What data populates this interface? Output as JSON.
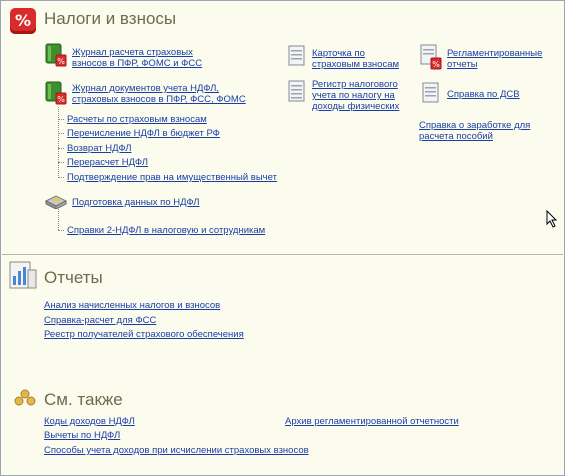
{
  "taxes": {
    "title": "Налоги и взносы",
    "badge": "%",
    "journal_insurance": [
      "Журнал расчета страховых",
      "взносов в ПФР, ФОМС и ФСС"
    ],
    "journal_docs": [
      "Журнал документов учета НДФЛ,",
      "страховых взносов в ПФР, ФСС, ФОМС"
    ],
    "doc_links": [
      "Расчеты по страховым взносам",
      "Перечисление НДФЛ в бюджет РФ",
      "Возврат НДФЛ",
      "Перерасчет НДФЛ",
      "Подтверждение прав на имущественный вычет"
    ],
    "prep_ndfl": "Подготовка данных по НДФЛ",
    "ref_2ndfl": "Справки 2-НДФЛ в налоговую и сотрудникам",
    "card_insurance": [
      "Карточка по",
      "страховым взносам"
    ],
    "register_ndfl": [
      "Регистр налогового",
      "учета по налогу на",
      "доходы физических"
    ],
    "reg_reports": [
      "Регламентированные",
      "отчеты"
    ],
    "dsv_ref": "Справка по ДСВ",
    "salary_ref": [
      "Справка о заработке для",
      "расчета пособий"
    ]
  },
  "reports": {
    "title": "Отчеты",
    "links": [
      "Анализ начисленных налогов и взносов",
      "Справка-расчет для ФСС",
      "Реестр получателей страхового обеспечения"
    ]
  },
  "see_also": {
    "title": "См. также",
    "links": [
      "Коды доходов НДФЛ",
      "Вычеты по НДФЛ",
      "Способы учета доходов при исчислении страховых взносов"
    ],
    "archive": "Архив регламентированной отчетности"
  },
  "colors": {
    "link": "#1a3ea8",
    "title": "#6e6a4c",
    "background": "#fcfcee",
    "badge": "#d92b2b"
  }
}
